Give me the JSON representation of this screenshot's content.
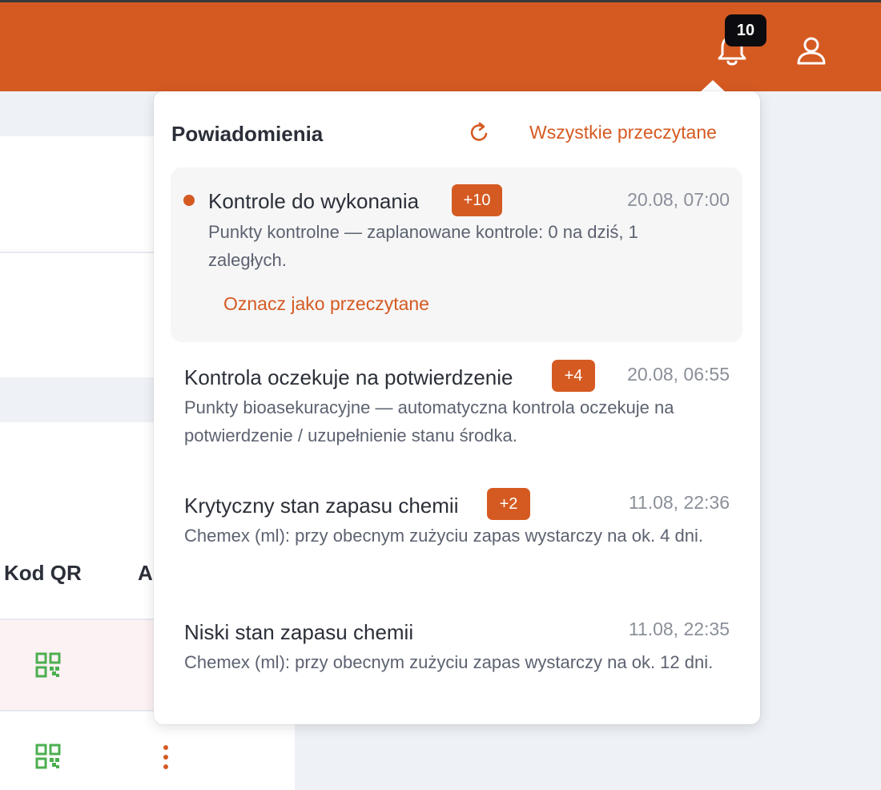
{
  "header": {
    "notification_count": "10",
    "bell_icon": "bell-icon",
    "user_icon": "user-icon",
    "brand_color": "#d55a22"
  },
  "background_table": {
    "columns": [
      "Kod QR",
      "A"
    ]
  },
  "notifications_panel": {
    "title": "Powiadomienia",
    "refresh_icon": "refresh-icon",
    "mark_all_label": "Wszystkie przeczytane",
    "items": [
      {
        "title": "Kontrole do wykonania",
        "count": "+10",
        "time": "20.08, 07:00",
        "description": "Punkty kontrolne — zaplanowane kontrole: 0 na dziś, 1 zaległych.",
        "unread": true,
        "mark_read_label": "Oznacz jako przeczytane"
      },
      {
        "title": "Kontrola oczekuje na potwierdzenie",
        "count": "+4",
        "time": "20.08, 06:55",
        "description": "Punkty bioasekuracyjne — automatyczna kontrola oczekuje na potwierdzenie / uzupełnienie stanu środka.",
        "unread": false
      },
      {
        "title": "Krytyczny stan zapasu chemii",
        "count": "+2",
        "time": "11.08, 22:36",
        "description": "Chemex (ml): przy obecnym zużyciu zapas wystarczy na ok. 4 dni.",
        "unread": false
      },
      {
        "title": "Niski stan zapasu chemii",
        "count": "",
        "time": "11.08, 22:35",
        "description": "Chemex (ml): przy obecnym zużyciu zapas wystarczy na ok. 12 dni.",
        "unread": false
      }
    ]
  }
}
